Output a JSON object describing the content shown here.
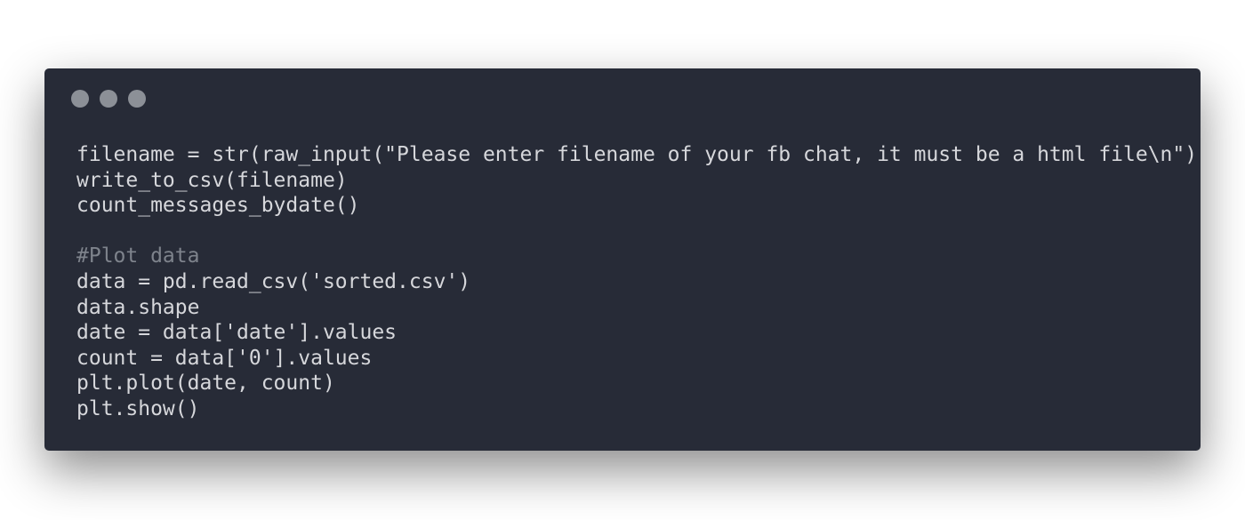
{
  "window": {
    "controls": [
      "window-control-1",
      "window-control-2",
      "window-control-3"
    ]
  },
  "code": {
    "lines": [
      [
        {
          "text": "filename = str(raw_input(\"Please enter filename of your fb chat, it must be a html file\\n\"))",
          "kind": "default"
        }
      ],
      [
        {
          "text": "write_to_csv(filename)",
          "kind": "default"
        }
      ],
      [
        {
          "text": "count_messages_bydate()",
          "kind": "default"
        }
      ],
      [
        {
          "text": "",
          "kind": "default"
        }
      ],
      [
        {
          "text": "#Plot data",
          "kind": "comment"
        }
      ],
      [
        {
          "text": "data = pd.read_csv('sorted.csv')",
          "kind": "default"
        }
      ],
      [
        {
          "text": "data.shape",
          "kind": "default"
        }
      ],
      [
        {
          "text": "date = data['date'].values",
          "kind": "default"
        }
      ],
      [
        {
          "text": "count = data['0'].values",
          "kind": "default"
        }
      ],
      [
        {
          "text": "plt.plot(date, count)",
          "kind": "default"
        }
      ],
      [
        {
          "text": "plt.show()",
          "kind": "default"
        }
      ]
    ]
  },
  "colors": {
    "window_background": "#272b37",
    "code_text": "#d6d7db",
    "comment_text": "#7e838c",
    "window_dot": "#8c9097",
    "page_background": "#ffffff"
  }
}
